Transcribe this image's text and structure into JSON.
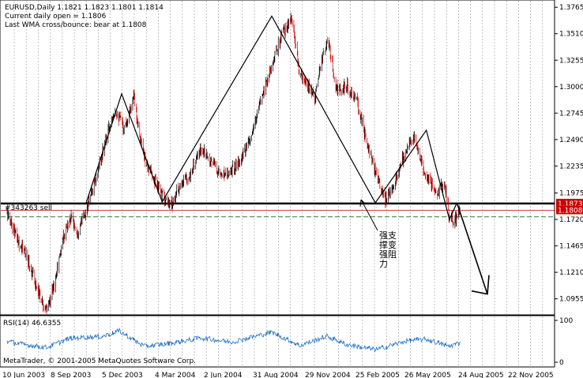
{
  "window": {
    "symbol_line": "EURUSD,Daily  1.1821 1.1823 1.1801 1.1814",
    "info_line_1": "Current daily open = 1.1806",
    "info_line_2": "Last WMA cross/bounce: bear at 1.1808",
    "footer": "MetaTrader, © 2001-2005 MetaQuotes Software Corp.",
    "order_label": "#343263 sell",
    "annotation_text": [
      "强支",
      "撑变",
      "强阻",
      "力"
    ]
  },
  "chart_data": [
    {
      "type": "line",
      "subtype": "candlestick-price",
      "title": "EURUSD,Daily",
      "colors": {
        "up": "#000000",
        "down": "#cc0000",
        "grid": "#999999",
        "resistance": "#000000",
        "red_level": "#cc0000",
        "green_level": "#2e7d32"
      },
      "x_ticks": [
        "10 Jun 2003",
        "8 Sep 2003",
        "5 Dec 2003",
        "4 Mar 2004",
        "2 Jun 2004",
        "31 Aug 2004",
        "29 Nov 2004",
        "25 Feb 2005",
        "26 May 2005",
        "24 Aug 2005",
        "22 Nov 2005"
      ],
      "y_ticks": [
        "1.3765",
        "1.3510",
        "1.3255",
        "1.3000",
        "1.2745",
        "1.2490",
        "1.2235",
        "1.1975",
        "1.1720",
        "1.1465",
        "1.1210",
        "1.0955"
      ],
      "ylim": [
        1.08,
        1.3835
      ],
      "price_anchors": [
        {
          "date": "2003-06-10",
          "close": 1.178
        },
        {
          "date": "2003-06-28",
          "close": 1.156
        },
        {
          "date": "2003-07-20",
          "close": 1.135
        },
        {
          "date": "2003-08-10",
          "close": 1.105
        },
        {
          "date": "2003-08-28",
          "close": 1.083
        },
        {
          "date": "2003-09-15",
          "close": 1.115
        },
        {
          "date": "2003-09-30",
          "close": 1.155
        },
        {
          "date": "2003-10-15",
          "close": 1.175
        },
        {
          "date": "2003-10-28",
          "close": 1.16
        },
        {
          "date": "2003-11-15",
          "close": 1.18
        },
        {
          "date": "2003-12-01",
          "close": 1.205
        },
        {
          "date": "2003-12-20",
          "close": 1.24
        },
        {
          "date": "2004-01-10",
          "close": 1.28
        },
        {
          "date": "2004-01-30",
          "close": 1.26
        },
        {
          "date": "2004-02-18",
          "close": 1.29
        },
        {
          "date": "2004-03-10",
          "close": 1.23
        },
        {
          "date": "2004-03-30",
          "close": 1.21
        },
        {
          "date": "2004-04-15",
          "close": 1.195
        },
        {
          "date": "2004-05-01",
          "close": 1.183
        },
        {
          "date": "2004-05-20",
          "close": 1.205
        },
        {
          "date": "2004-06-10",
          "close": 1.215
        },
        {
          "date": "2004-07-01",
          "close": 1.24
        },
        {
          "date": "2004-07-20",
          "close": 1.23
        },
        {
          "date": "2004-08-10",
          "close": 1.215
        },
        {
          "date": "2004-09-01",
          "close": 1.22
        },
        {
          "date": "2004-09-20",
          "close": 1.23
        },
        {
          "date": "2004-10-10",
          "close": 1.25
        },
        {
          "date": "2004-10-30",
          "close": 1.29
        },
        {
          "date": "2004-11-20",
          "close": 1.32
        },
        {
          "date": "2004-12-10",
          "close": 1.35
        },
        {
          "date": "2004-12-30",
          "close": 1.365
        },
        {
          "date": "2005-01-15",
          "close": 1.31
        },
        {
          "date": "2005-02-01",
          "close": 1.3
        },
        {
          "date": "2005-02-15",
          "close": 1.29
        },
        {
          "date": "2005-03-01",
          "close": 1.33
        },
        {
          "date": "2005-03-12",
          "close": 1.345
        },
        {
          "date": "2005-03-31",
          "close": 1.295
        },
        {
          "date": "2005-04-20",
          "close": 1.3
        },
        {
          "date": "2005-05-10",
          "close": 1.285
        },
        {
          "date": "2005-06-01",
          "close": 1.24
        },
        {
          "date": "2005-06-20",
          "close": 1.21
        },
        {
          "date": "2005-07-05",
          "close": 1.19
        },
        {
          "date": "2005-07-20",
          "close": 1.205
        },
        {
          "date": "2005-08-05",
          "close": 1.225
        },
        {
          "date": "2005-08-20",
          "close": 1.245
        },
        {
          "date": "2005-09-01",
          "close": 1.25
        },
        {
          "date": "2005-09-20",
          "close": 1.22
        },
        {
          "date": "2005-10-05",
          "close": 1.205
        },
        {
          "date": "2005-10-20",
          "close": 1.2
        },
        {
          "date": "2005-11-01",
          "close": 1.205
        },
        {
          "date": "2005-11-10",
          "close": 1.175
        },
        {
          "date": "2005-11-20",
          "close": 1.17
        },
        {
          "date": "2005-12-01",
          "close": 1.1814
        }
      ],
      "pattern_lines": [
        {
          "name": "pattern",
          "points": [
            [
              "2003-11-15",
              1.188
            ],
            [
              "2004-01-25",
              1.293
            ],
            [
              "2004-04-15",
              1.189
            ],
            [
              "2004-11-20",
              1.368
            ],
            [
              "2005-06-15",
              1.188
            ],
            [
              "2005-09-25",
              1.258
            ],
            [
              "2005-11-10",
              1.172
            ],
            [
              "2005-11-25",
              1.188
            ]
          ]
        },
        {
          "name": "projection",
          "points": [
            [
              "2005-11-25",
              1.188
            ],
            [
              "2006-01-25",
              1.1
            ]
          ]
        }
      ],
      "levels": [
        {
          "name": "resistance",
          "value": 1.1873,
          "label": "1.1873"
        },
        {
          "name": "red_level",
          "value": 1.1808,
          "label": "1.1808"
        },
        {
          "name": "green_level",
          "value": 1.1745
        }
      ]
    },
    {
      "type": "line",
      "title": "RSI(14) 46.6355",
      "ylim": [
        0,
        100
      ],
      "y_ticks": [
        "100",
        "0"
      ],
      "color": "#1e6fc8",
      "anchors": [
        {
          "date": "2003-06-10",
          "value": 50
        },
        {
          "date": "2003-07-15",
          "value": 42
        },
        {
          "date": "2003-08-28",
          "value": 35
        },
        {
          "date": "2003-10-15",
          "value": 58
        },
        {
          "date": "2003-12-20",
          "value": 62
        },
        {
          "date": "2004-01-20",
          "value": 75
        },
        {
          "date": "2004-03-10",
          "value": 38
        },
        {
          "date": "2004-05-01",
          "value": 45
        },
        {
          "date": "2004-07-01",
          "value": 58
        },
        {
          "date": "2004-09-01",
          "value": 48
        },
        {
          "date": "2004-11-20",
          "value": 72
        },
        {
          "date": "2005-01-15",
          "value": 40
        },
        {
          "date": "2005-03-10",
          "value": 62
        },
        {
          "date": "2005-04-20",
          "value": 42
        },
        {
          "date": "2005-06-15",
          "value": 30
        },
        {
          "date": "2005-08-20",
          "value": 52
        },
        {
          "date": "2005-09-25",
          "value": 55
        },
        {
          "date": "2005-11-10",
          "value": 38
        },
        {
          "date": "2005-12-01",
          "value": 46.6355
        }
      ]
    }
  ]
}
